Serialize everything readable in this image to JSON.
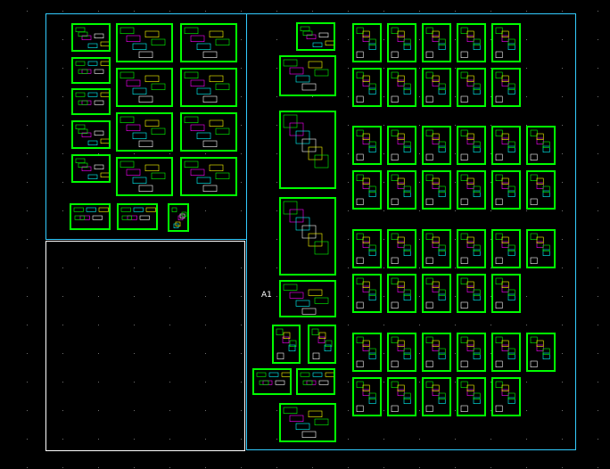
{
  "drawing": {
    "background": "#000000",
    "frame_color": "#ffffff",
    "frame_cyan": "#33ccff",
    "sheet_color": "#00ff00",
    "label_a1": "A1"
  }
}
